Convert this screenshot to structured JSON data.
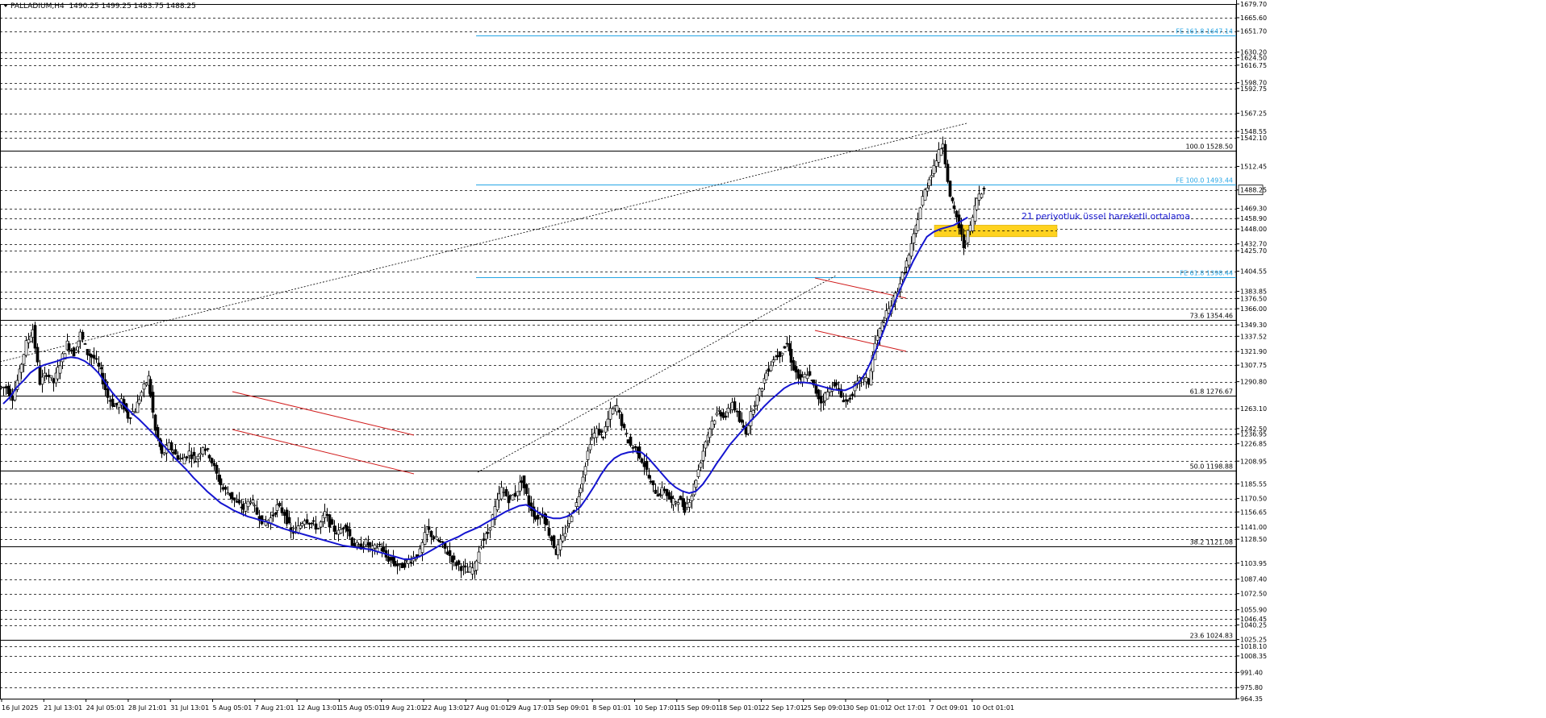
{
  "header": {
    "symbol": "PALLADIUM,H4",
    "ohlc": "1490.25 1499.25 1483.75 1488.25"
  },
  "colors": {
    "background": "#ffffff",
    "grid": "#000000",
    "ema": "#1515d0",
    "fibo_extension": "#26a6e6",
    "channel": "#d01a1a",
    "highlight_zone": "#ffd21f",
    "candles": "#000000",
    "annotation": "#1515d0"
  },
  "annotation_text": "21 periyotluk üssel hareketli ortalama",
  "chart_data": {
    "type": "candlestick",
    "instrument": "PALLADIUM",
    "timeframe": "H4",
    "ylim": [
      964.35,
      1679.7
    ],
    "y_ticks": [
      1679.7,
      1665.6,
      1651.7,
      1630.2,
      1624.5,
      1616.75,
      1598.7,
      1592.75,
      1567.25,
      1548.55,
      1542.1,
      1512.45,
      1488.25,
      1469.3,
      1458.9,
      1448.0,
      1432.7,
      1425.7,
      1404.55,
      1383.85,
      1376.5,
      1366.0,
      1349.3,
      1337.52,
      1321.9,
      1307.75,
      1290.8,
      1263.1,
      1242.5,
      1236.95,
      1226.85,
      1208.95,
      1185.55,
      1170.5,
      1156.65,
      1141.0,
      1128.5,
      1103.95,
      1087.4,
      1072.5,
      1055.9,
      1046.45,
      1040.25,
      1025.25,
      1018.1,
      1008.35,
      991.4,
      975.8,
      964.35
    ],
    "highlighted_ticks": [
      1488.25
    ],
    "x_ticks": [
      "16 Jul 2025",
      "21 Jul 13:01",
      "24 Jul 05:01",
      "28 Jul 21:01",
      "31 Jul 13:01",
      "5 Aug 05:01",
      "7 Aug 21:01",
      "12 Aug 13:01",
      "15 Aug 05:01",
      "19 Aug 21:01",
      "22 Aug 13:01",
      "27 Aug 01:01",
      "29 Aug 17:01",
      "3 Sep 09:01",
      "8 Sep 01:01",
      "10 Sep 17:01",
      "15 Sep 09:01",
      "18 Sep 01:01",
      "22 Sep 17:01",
      "25 Sep 09:01",
      "30 Sep 01:01",
      "2 Oct 17:01",
      "7 Oct 09:01",
      "10 Oct 01:01"
    ],
    "fibo_retracement": [
      {
        "label": "100.0 1528.50",
        "value": 1528.5
      },
      {
        "label": "73.6 1354.46",
        "value": 1354.46
      },
      {
        "label": "61.8 1276.67",
        "value": 1276.67
      },
      {
        "label": "50.0 1198.88",
        "value": 1198.88
      },
      {
        "label": "38.2 1121.08",
        "value": 1121.08
      },
      {
        "label": "23.6 1024.83",
        "value": 1024.83
      }
    ],
    "fibo_extension": [
      {
        "label": "FE 161.8 1647.14",
        "value": 1647.14
      },
      {
        "label": "FE 100.0 1493.44",
        "value": 1493.44
      },
      {
        "label": "FE 61.8 1398.44",
        "value": 1398.44
      }
    ],
    "highlight_zone": [
      1440.0,
      1452.0
    ],
    "price_path": [
      1285,
      1275,
      1300,
      1330,
      1345,
      1290,
      1300,
      1290,
      1310,
      1330,
      1320,
      1340,
      1320,
      1315,
      1300,
      1275,
      1265,
      1270,
      1255,
      1262,
      1280,
      1295,
      1240,
      1215,
      1225,
      1215,
      1210,
      1218,
      1210,
      1225,
      1215,
      1195,
      1180,
      1175,
      1165,
      1160,
      1170,
      1155,
      1145,
      1150,
      1162,
      1155,
      1135,
      1140,
      1150,
      1145,
      1140,
      1155,
      1140,
      1135,
      1145,
      1125,
      1120,
      1125,
      1118,
      1122,
      1110,
      1105,
      1100,
      1105,
      1110,
      1115,
      1140,
      1130,
      1125,
      1115,
      1105,
      1100,
      1095,
      1100,
      1125,
      1135,
      1160,
      1180,
      1170,
      1175,
      1190,
      1165,
      1150,
      1155,
      1135,
      1115,
      1130,
      1150,
      1165,
      1195,
      1230,
      1240,
      1235,
      1260,
      1265,
      1240,
      1225,
      1220,
      1205,
      1185,
      1175,
      1180,
      1165,
      1170,
      1160,
      1175,
      1200,
      1230,
      1250,
      1260,
      1255,
      1270,
      1250,
      1240,
      1265,
      1280,
      1300,
      1315,
      1320,
      1330,
      1305,
      1290,
      1300,
      1285,
      1270,
      1280,
      1290,
      1275,
      1270,
      1285,
      1295,
      1290,
      1330,
      1350,
      1365,
      1380,
      1400,
      1420,
      1450,
      1480,
      1500,
      1520,
      1538,
      1480,
      1460,
      1430,
      1450,
      1480,
      1492
    ],
    "ema21_path": [
      1268,
      1275,
      1285,
      1292,
      1300,
      1305,
      1308,
      1310,
      1312,
      1315,
      1316,
      1315,
      1312,
      1307,
      1300,
      1290,
      1280,
      1272,
      1265,
      1258,
      1252,
      1245,
      1238,
      1230,
      1222,
      1214,
      1207,
      1200,
      1192,
      1185,
      1178,
      1172,
      1166,
      1162,
      1158,
      1155,
      1152,
      1150,
      1148,
      1146,
      1143,
      1140,
      1138,
      1136,
      1134,
      1132,
      1130,
      1128,
      1126,
      1124,
      1122,
      1121,
      1120,
      1119,
      1118,
      1116,
      1114,
      1112,
      1110,
      1108,
      1108,
      1110,
      1113,
      1117,
      1121,
      1125,
      1128,
      1131,
      1135,
      1138,
      1141,
      1145,
      1149,
      1153,
      1157,
      1160,
      1163,
      1164,
      1160,
      1155,
      1152,
      1150,
      1150,
      1152,
      1156,
      1162,
      1172,
      1183,
      1195,
      1205,
      1212,
      1216,
      1218,
      1219,
      1218,
      1212,
      1204,
      1196,
      1188,
      1182,
      1178,
      1176,
      1178,
      1185,
      1195,
      1206,
      1216,
      1226,
      1234,
      1242,
      1250,
      1257,
      1265,
      1272,
      1278,
      1284,
      1288,
      1290,
      1290,
      1289,
      1287,
      1285,
      1283,
      1282,
      1282,
      1285,
      1290,
      1300,
      1315,
      1332,
      1350,
      1368,
      1385,
      1400,
      1415,
      1428,
      1440,
      1445,
      1448,
      1450,
      1452,
      1456,
      1460
    ]
  }
}
